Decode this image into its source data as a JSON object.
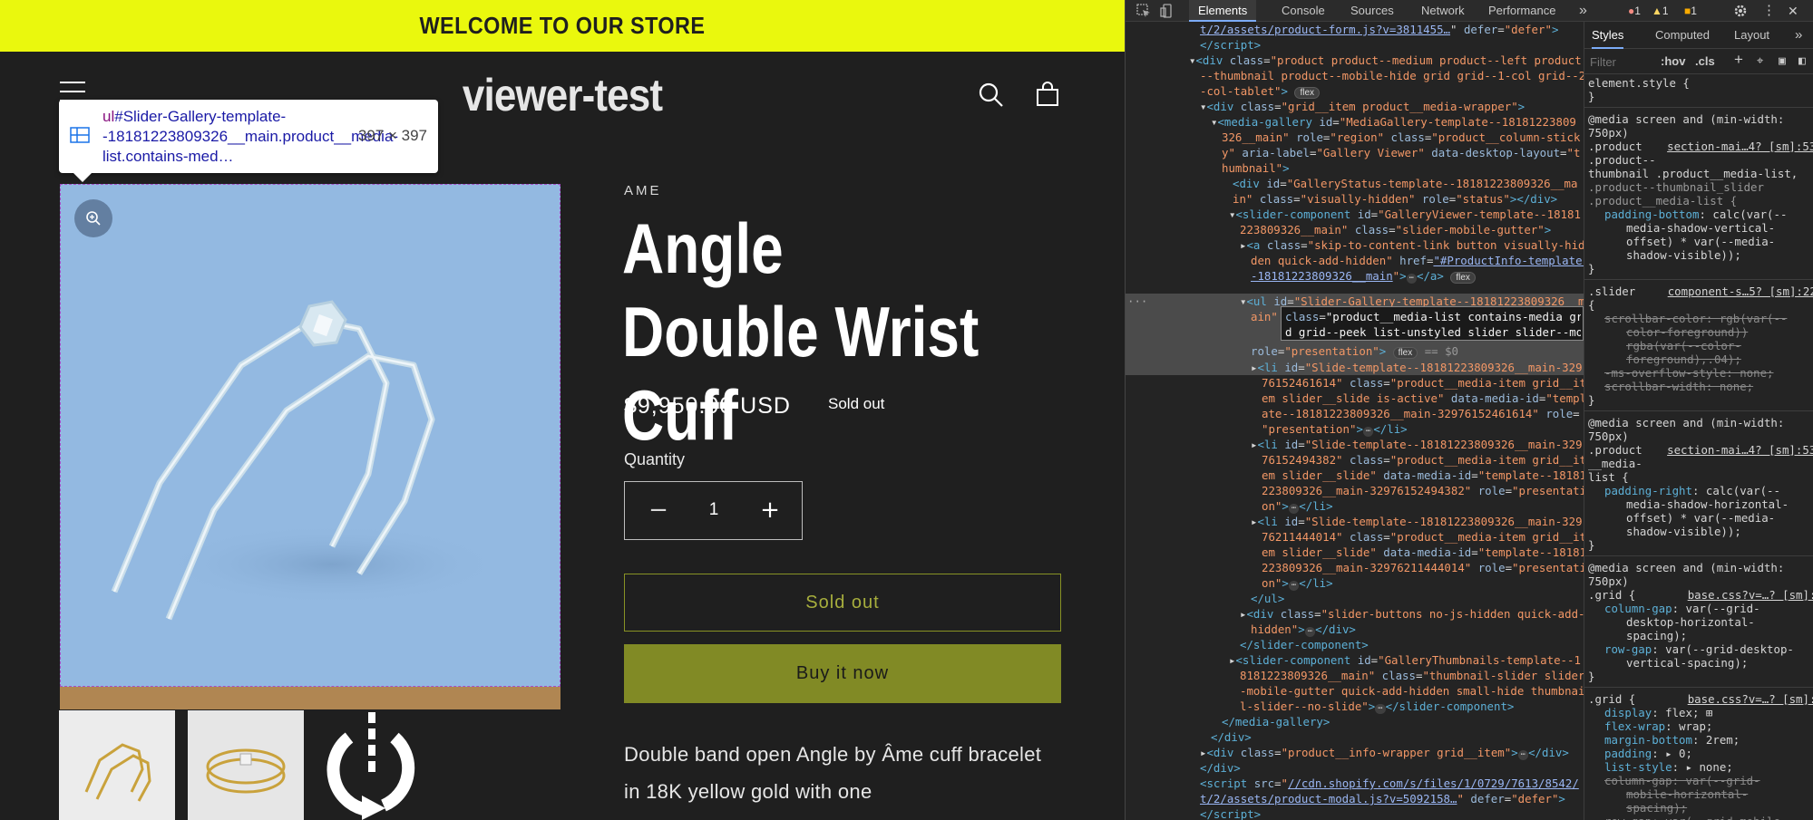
{
  "store": {
    "announcement": "WELCOME TO OUR STORE",
    "logo": "viewer-test",
    "vendor": "AME",
    "title": "Angle Double Wrist Cuff",
    "price": "$9,950.00 USD",
    "badge": "Sold out",
    "quantity_label": "Quantity",
    "quantity_value": "1",
    "sold_out_button": "Sold out",
    "buy_button": "Buy it now",
    "description": "Double band open Angle by Âme cuff bracelet in 18K yellow gold with one",
    "colors": {
      "announcement_bg": "#eaf80d",
      "media_bg": "#93b9e1",
      "buy_bg": "#818a25"
    }
  },
  "inspector_tooltip": {
    "tag": "ul",
    "selector": "#Slider-Gallery-template--18181223809326__main.product__media-list.contains-med…",
    "size": "397 × 397"
  },
  "devtools": {
    "tabs": [
      "Elements",
      "Console",
      "Sources",
      "Network",
      "Performance"
    ],
    "active_tab": "Elements",
    "more": "»",
    "errors": "1",
    "warnings": "1",
    "issues": "1",
    "styles_tabs": [
      "Styles",
      "Computed",
      "Layout"
    ],
    "filter_placeholder": "Filter",
    "filter_toggles": [
      ":hov",
      ".cls",
      "+"
    ]
  }
}
